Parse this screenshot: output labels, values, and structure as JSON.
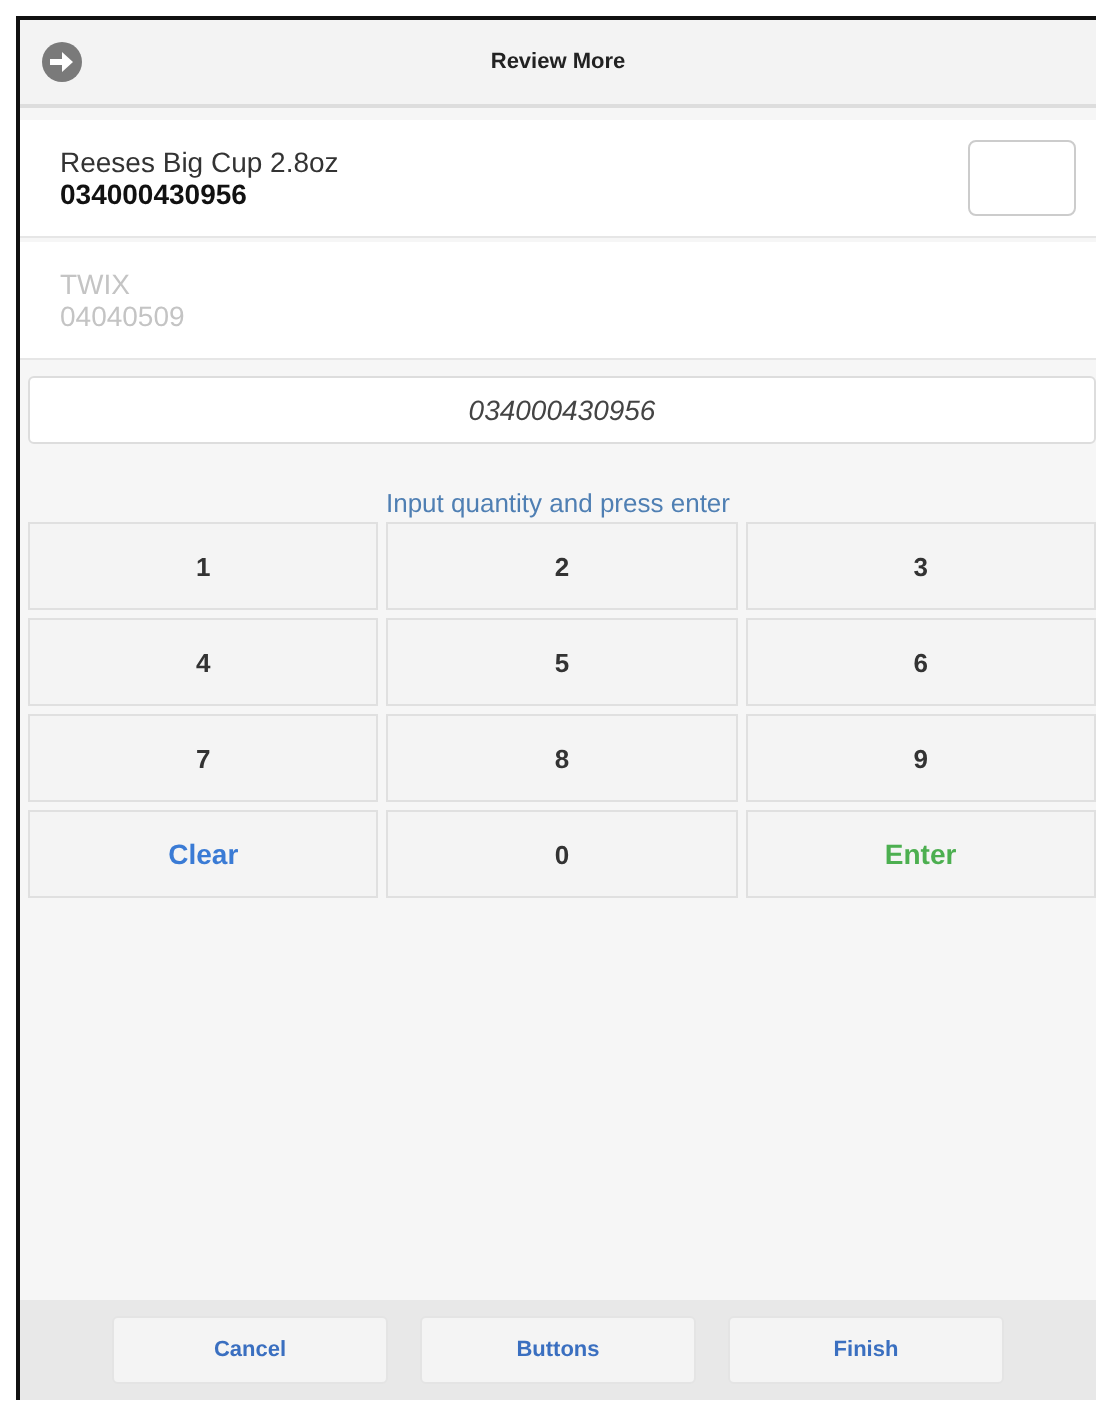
{
  "header": {
    "title": "Review More"
  },
  "items": [
    {
      "name": "Reeses Big Cup 2.8oz",
      "code": "034000430956",
      "disabled": false
    },
    {
      "name": "TWIX",
      "code": "04040509",
      "disabled": true
    }
  ],
  "scan_field": {
    "value": "034000430956"
  },
  "instruction": "Input quantity and press enter",
  "keys": [
    {
      "label": "1",
      "kind": "digit"
    },
    {
      "label": "2",
      "kind": "digit"
    },
    {
      "label": "3",
      "kind": "digit"
    },
    {
      "label": "4",
      "kind": "digit"
    },
    {
      "label": "5",
      "kind": "digit"
    },
    {
      "label": "6",
      "kind": "digit"
    },
    {
      "label": "7",
      "kind": "digit"
    },
    {
      "label": "8",
      "kind": "digit"
    },
    {
      "label": "9",
      "kind": "digit"
    },
    {
      "label": "Clear",
      "kind": "clear"
    },
    {
      "label": "0",
      "kind": "digit"
    },
    {
      "label": "Enter",
      "kind": "enter"
    }
  ],
  "footer_buttons": [
    "Cancel",
    "Buttons",
    "Finish"
  ]
}
